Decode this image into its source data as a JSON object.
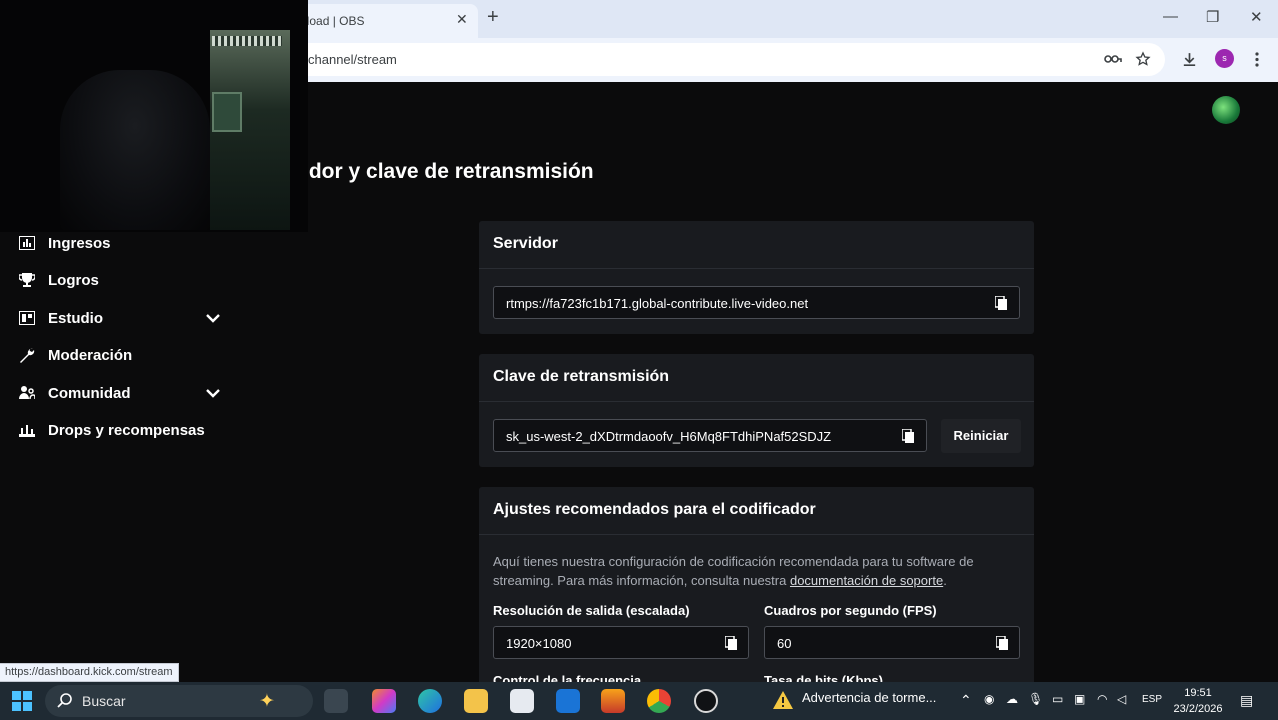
{
  "browser": {
    "tab_title": "nload | OBS",
    "tab_close": "✕",
    "new_tab": "+",
    "url": "channel/stream",
    "status_url": "https://dashboard.kick.com/stream",
    "profile_initial": "s",
    "window_controls": {
      "minimize": "—",
      "restore": "❐",
      "close": "✕"
    }
  },
  "page": {
    "title": "idor y clave de retransmisión"
  },
  "sidebar": {
    "items": [
      {
        "label": "Ingresos",
        "icon": "chart-icon",
        "expandable": false
      },
      {
        "label": "Logros",
        "icon": "trophy-icon",
        "expandable": false
      },
      {
        "label": "Estudio",
        "icon": "studio-icon",
        "expandable": true
      },
      {
        "label": "Moderación",
        "icon": "wrench-icon",
        "expandable": false
      },
      {
        "label": "Comunidad",
        "icon": "community-icon",
        "expandable": true
      },
      {
        "label": "Drops y recompensas",
        "icon": "gift-icon",
        "expandable": false
      }
    ]
  },
  "server": {
    "title": "Servidor",
    "value": "rtmps://fa723fc1b171.global-contribute.live-video.net"
  },
  "stream_key": {
    "title": "Clave de retransmisión",
    "value": "sk_us-west-2_dXDtrmdaoofv_H6Mq8FTdhiPNaf52SDJZ",
    "reset_label": "Reiniciar"
  },
  "encoder": {
    "title": "Ajustes recomendados para el codificador",
    "description": "Aquí tienes nuestra configuración de codificación recomendada para tu software de streaming. Para más información, consulta nuestra ",
    "doc_link": "documentación de soporte",
    "description_end": ".",
    "resolution_label": "Resolución de salida (escalada)",
    "resolution_value": "1920×1080",
    "fps_label": "Cuadros por segundo (FPS)",
    "fps_value": "60",
    "rate_control_label": "Control de la frecuencia",
    "bitrate_label": "Tasa de bits (Kbps)"
  },
  "taskbar": {
    "search_placeholder": "Buscar",
    "weather_text": "Advertencia de torme...",
    "language": "ESP",
    "time": "19:51",
    "date": "23/2/2026"
  }
}
